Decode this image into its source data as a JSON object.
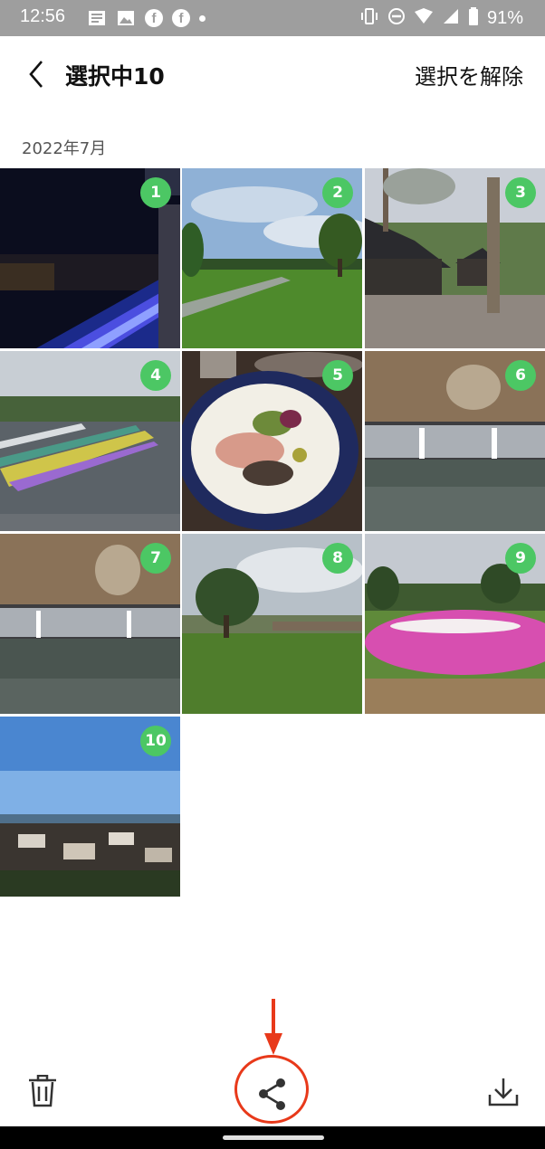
{
  "status_bar": {
    "time": "12:56",
    "battery": "91%",
    "notification_icons": [
      "news-icon",
      "image-icon",
      "facebook-icon",
      "facebook-icon",
      "dot-icon"
    ],
    "system_icons": [
      "vibrate-icon",
      "do-not-disturb-icon",
      "wifi-icon",
      "signal-icon",
      "battery-icon"
    ]
  },
  "header": {
    "title": "選択中10",
    "deselect_label": "選択を解除"
  },
  "section": {
    "date": "2022年7月"
  },
  "photos": [
    {
      "index": "1",
      "scene": "night illuminations"
    },
    {
      "index": "2",
      "scene": "park lawn"
    },
    {
      "index": "3",
      "scene": "wooden cabins forest"
    },
    {
      "index": "4",
      "scene": "lake swan boats"
    },
    {
      "index": "5",
      "scene": "dinner plate"
    },
    {
      "index": "6",
      "scene": "waterfall"
    },
    {
      "index": "7",
      "scene": "waterfall"
    },
    {
      "index": "8",
      "scene": "grass field"
    },
    {
      "index": "9",
      "scene": "pink flower field"
    },
    {
      "index": "10",
      "scene": "town view blue sky"
    }
  ],
  "bottom_bar": {
    "actions": [
      "trash-icon",
      "share-icon",
      "download-icon"
    ]
  },
  "colors": {
    "status_bar": "#9e9e9e",
    "badge": "#4cc764",
    "highlight": "#e8391a"
  }
}
